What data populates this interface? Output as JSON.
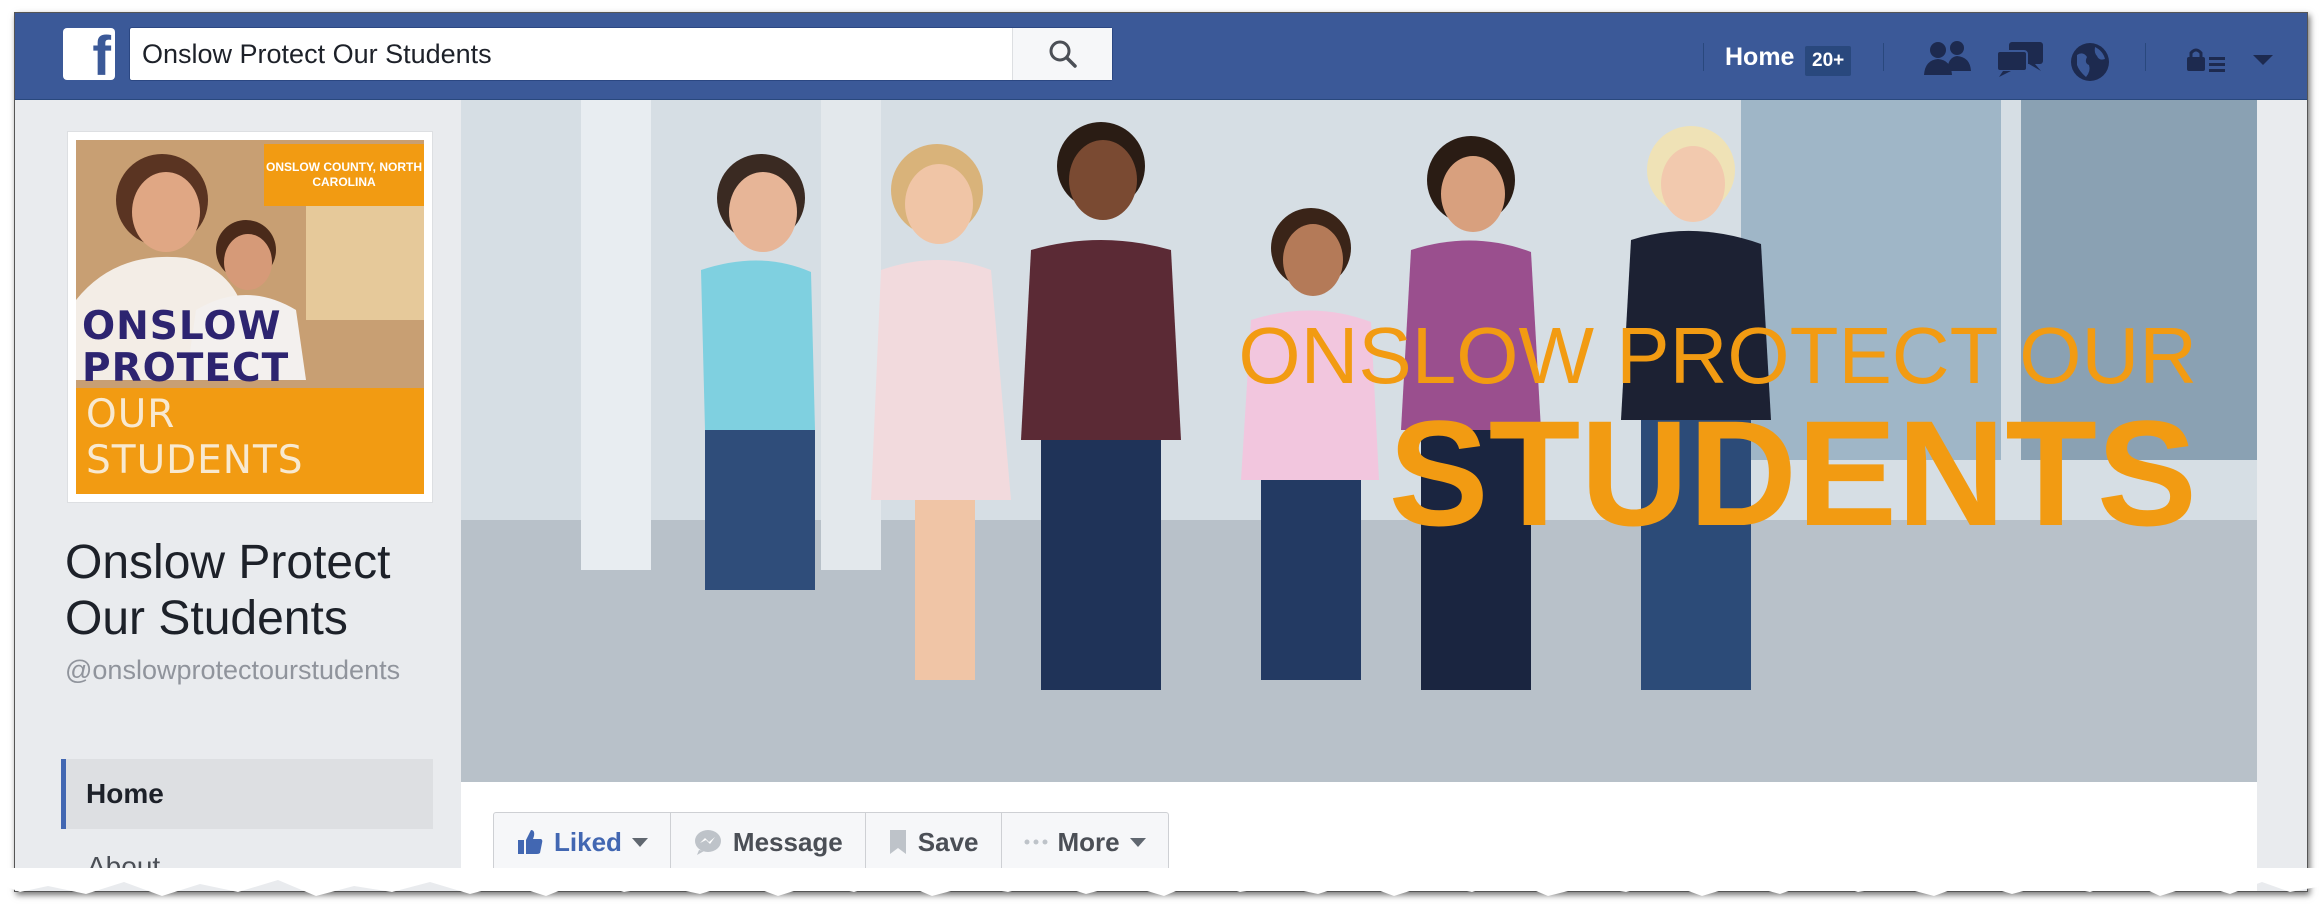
{
  "topbar": {
    "logo_letter": "f",
    "search_value": "Onslow Protect Our Students",
    "home_label": "Home",
    "home_badge": "20+",
    "icons": [
      "friend-requests-icon",
      "messages-icon",
      "notifications-globe-icon",
      "quick-help-lock-icon",
      "account-dropdown-icon"
    ]
  },
  "profile": {
    "pic_tag": "ONSLOW COUNTY, NORTH CAROLINA",
    "pic_title_line1": "ONSLOW",
    "pic_title_line2": "PROTECT",
    "pic_sub_line1": "OUR",
    "pic_sub_line2": "STUDENTS",
    "name_line1": "Onslow Protect",
    "name_line2": "Our Students",
    "handle": "@onslowprotectourstudents"
  },
  "left_nav": {
    "home": "Home",
    "about": "About"
  },
  "cover": {
    "title_line1": "ONSLOW PROTECT OUR",
    "title_line2": "STUDENTS"
  },
  "actions": {
    "liked": "Liked",
    "message": "Message",
    "save": "Save",
    "more": "More"
  },
  "colors": {
    "fb_blue": "#3b5998",
    "brand_orange": "#f29b12",
    "brand_navy": "#2d2470"
  }
}
